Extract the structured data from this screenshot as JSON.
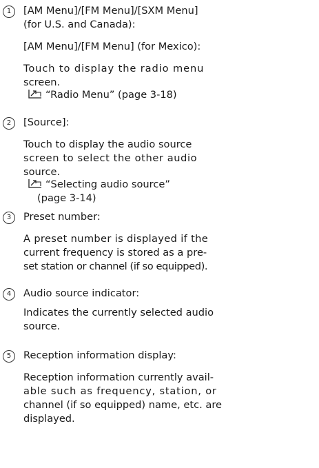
{
  "items": [
    {
      "number": "1",
      "label_1": "[AM Menu]/[FM Menu]/[SXM Menu]",
      "label_2": "(for U.S. and Canada):",
      "label_3": "[AM Menu]/[FM Menu] (for Mexico):",
      "desc_1": "Touch to display the radio menu",
      "desc_2": "screen.",
      "ref_text": "“Radio Menu” (page 3-18)",
      "ref_icon": "reference-arrow-icon"
    },
    {
      "number": "2",
      "label": "[Source]:",
      "desc_1": "Touch to display the audio source",
      "desc_2": "screen to select the other audio",
      "desc_3": "source.",
      "ref_text_1": "“Selecting audio source”",
      "ref_text_2": "(page 3-14)",
      "ref_icon": "reference-arrow-icon"
    },
    {
      "number": "3",
      "label": "Preset number:",
      "desc_1": "A preset number is displayed if the",
      "desc_2": "current frequency is stored as a pre-",
      "desc_3": "set station or channel (if so equipped)."
    },
    {
      "number": "4",
      "label": "Audio source indicator:",
      "desc_1": "Indicates the currently selected audio",
      "desc_2": "source."
    },
    {
      "number": "5",
      "label": "Reception information display:",
      "desc_1": "Reception information currently avail-",
      "desc_2": "able such as frequency, station, or",
      "desc_3": "channel (if so equipped) name, etc. are",
      "desc_4": "displayed."
    }
  ]
}
